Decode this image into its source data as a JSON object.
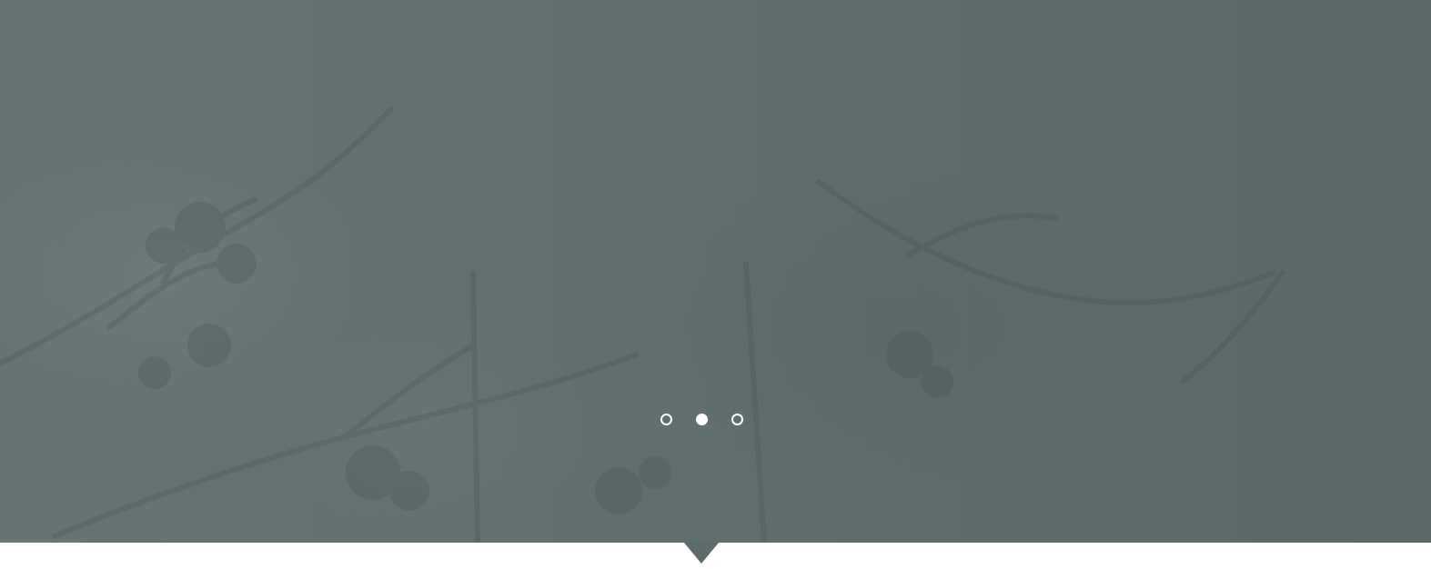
{
  "hero": {
    "background_image": "winter-branches-icon",
    "background_tint": "#5e6b6b"
  },
  "carousel": {
    "slides": [
      {
        "state": "inactive"
      },
      {
        "state": "active"
      },
      {
        "state": "inactive"
      }
    ],
    "active_index": 1,
    "dot_color": "#ffffff"
  },
  "colors": {
    "hero_tint": "#5e6b6b",
    "page_background": "#ffffff"
  }
}
